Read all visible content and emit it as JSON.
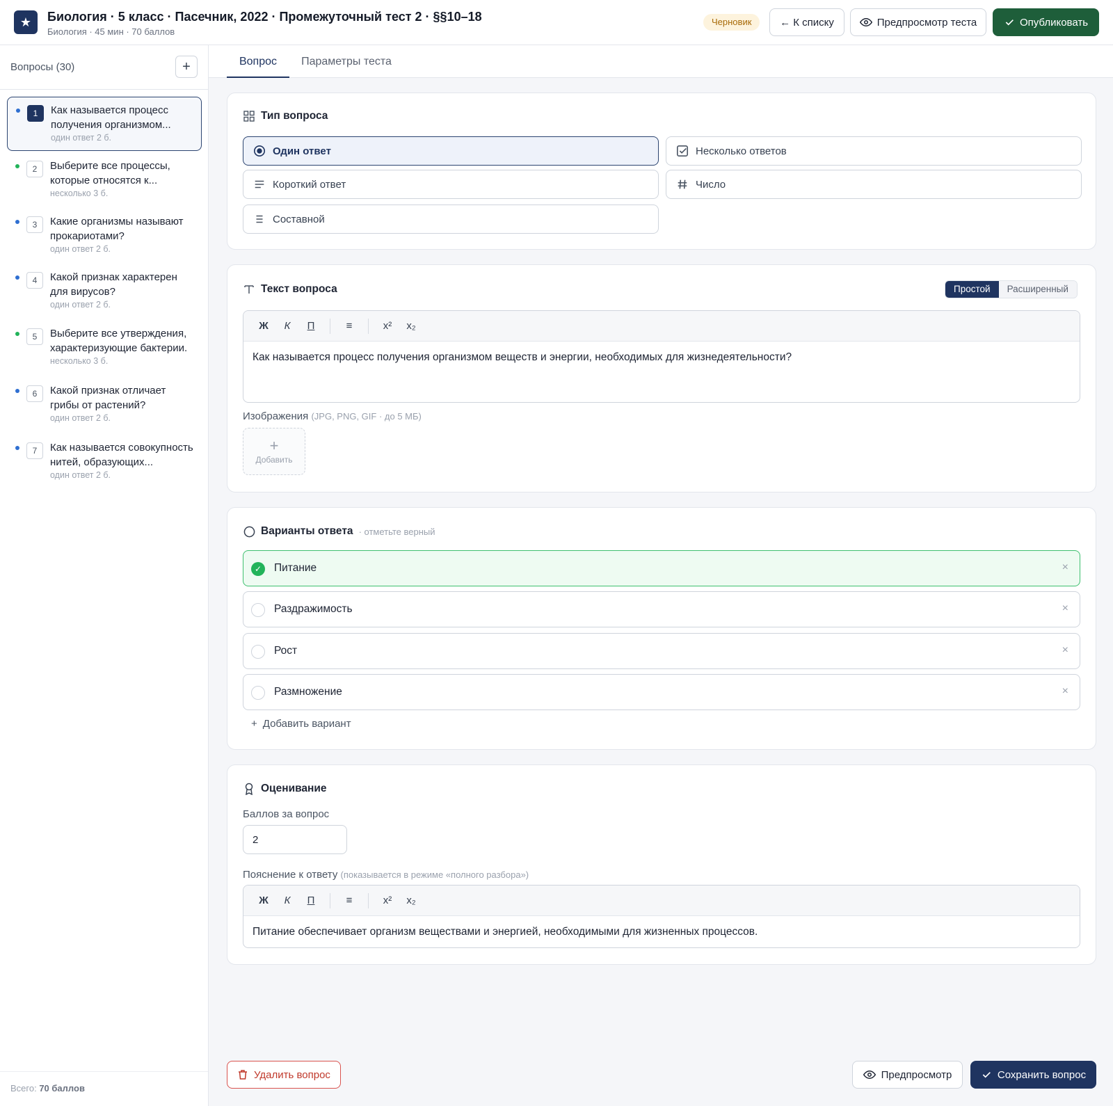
{
  "header": {
    "title": "Биология · 5 класс · Пасечник, 2022 · Промежуточный тест 2 · §§10–18",
    "subtitle": "Биология · 45 мин · 70 баллов",
    "status_badge": "Черновик",
    "back_label": "← К списку",
    "preview_label": "Предпросмотр теста",
    "publish_label": "Опубликовать"
  },
  "sidebar": {
    "title": "Вопросы (30)",
    "items": [
      {
        "num": "1",
        "text": "Как называется процесс получения организмом...",
        "meta": "один ответ  2 б.",
        "dot": "#2f6fd1"
      },
      {
        "num": "2",
        "text": "Выберите все процессы, которые относятся к...",
        "meta": "несколько  3 б.",
        "dot": "#22b35a"
      },
      {
        "num": "3",
        "text": "Какие организмы называют прокариотами?",
        "meta": "один ответ  2 б.",
        "dot": "#2f6fd1"
      },
      {
        "num": "4",
        "text": "Какой признак характерен для вирусов?",
        "meta": "один ответ  2 б.",
        "dot": "#2f6fd1"
      },
      {
        "num": "5",
        "text": "Выберите все утверждения, характеризующие бактерии.",
        "meta": "несколько  3 б.",
        "dot": "#22b35a"
      },
      {
        "num": "6",
        "text": "Какой признак отличает грибы от растений?",
        "meta": "один ответ  2 б.",
        "dot": "#2f6fd1"
      },
      {
        "num": "7",
        "text": "Как называется совокупность нитей, образующих...",
        "meta": "один ответ  2 б.",
        "dot": "#2f6fd1"
      }
    ],
    "total_prefix": "Всего:",
    "total_value": "70 баллов"
  },
  "tabs": [
    "Вопрос",
    "Параметры теста"
  ],
  "question_type": {
    "title": "Тип вопроса",
    "options": [
      "Один ответ",
      "Несколько ответов",
      "Короткий ответ",
      "Число",
      "Составной"
    ],
    "selected": "Один ответ"
  },
  "question_text": {
    "title": "Текст вопроса",
    "mode_simple": "Простой",
    "mode_advanced": "Расширенный",
    "toolbar": [
      "Ж",
      "К",
      "П",
      "≡",
      "x²",
      "x₂"
    ],
    "body": "Как называется процесс получения организмом веществ и энергии, необходимых для жизнедеятельности?",
    "images_label": "Изображения",
    "images_hint": "(JPG, PNG, GIF · до 5 МБ)",
    "add_image_label": "Добавить"
  },
  "answers": {
    "title": "Варианты ответа",
    "hint": "· отметьте верный",
    "items": [
      {
        "text": "Питание",
        "correct": true
      },
      {
        "text": "Раздражимость",
        "correct": false
      },
      {
        "text": "Рост",
        "correct": false
      },
      {
        "text": "Размножение",
        "correct": false
      }
    ],
    "add_label": "Добавить вариант"
  },
  "grading": {
    "title": "Оценивание",
    "points_label": "Баллов за вопрос",
    "points_value": "2",
    "explanation_label": "Пояснение к ответу",
    "explanation_hint": "(показывается в режиме «полного разбора»)",
    "explanation_body": "Питание обеспечивает организм веществами и энергией, необходимыми для жизненных процессов."
  },
  "footer": {
    "delete_label": "Удалить вопрос",
    "preview_label": "Предпросмотр",
    "save_label": "Сохранить вопрос"
  },
  "colors": {
    "primary": "#1f3460",
    "publish": "#1e5e3a",
    "correct": "#22b35a",
    "danger": "#c0392b"
  }
}
